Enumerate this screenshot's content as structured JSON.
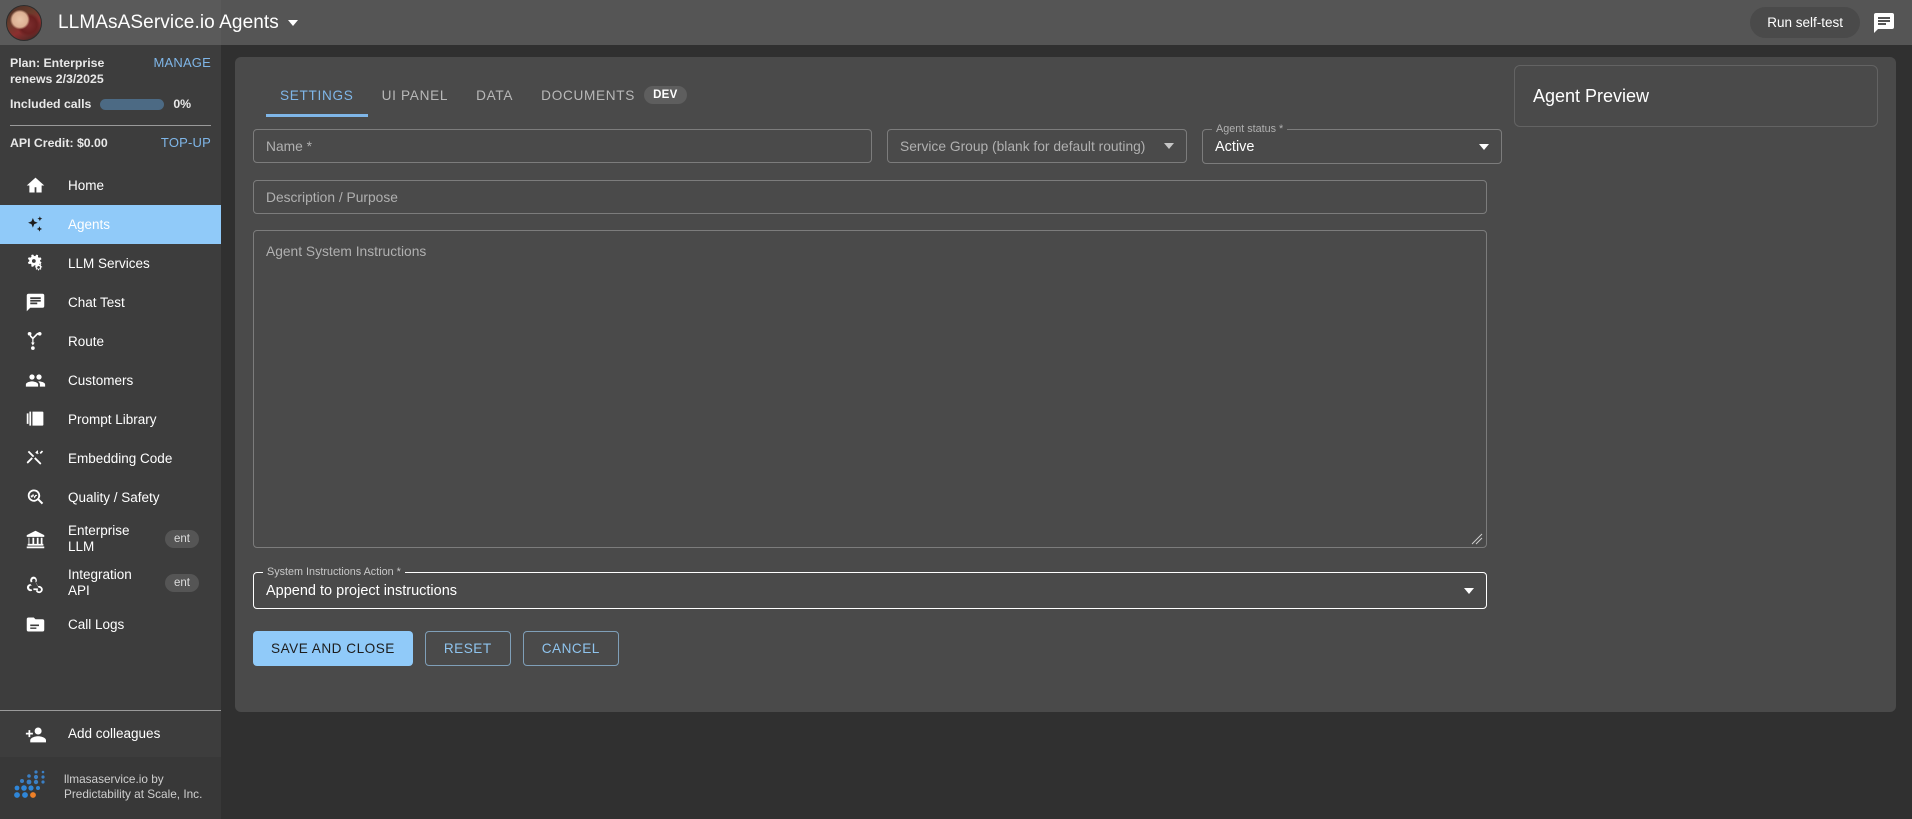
{
  "topbar": {
    "app_title": "LLMAsAService.io Agents",
    "dropdown_icon": "caret-down-icon",
    "avatar": "user-avatar",
    "selftest_label": "Run self-test",
    "chat_icon": "chat-bubble-icon"
  },
  "sidebar": {
    "plan_line1": "Plan: Enterprise",
    "plan_line2": "renews 2/3/2025",
    "manage_label": "MANAGE",
    "included_calls_label": "Included calls",
    "included_calls_pct": "0%",
    "included_calls_value": 0,
    "api_credit_label": "API Credit: $0.00",
    "topup_label": "TOP-UP",
    "items": [
      {
        "label": "Home",
        "icon": "home-icon",
        "active": false,
        "badge": ""
      },
      {
        "label": "Agents",
        "icon": "sparkles-icon",
        "active": true,
        "badge": ""
      },
      {
        "label": "LLM Services",
        "icon": "gears-icon",
        "active": false,
        "badge": ""
      },
      {
        "label": "Chat Test",
        "icon": "chat-bubble-icon",
        "active": false,
        "badge": ""
      },
      {
        "label": "Route",
        "icon": "route-branch-icon",
        "active": false,
        "badge": ""
      },
      {
        "label": "Customers",
        "icon": "people-icon",
        "active": false,
        "badge": ""
      },
      {
        "label": "Prompt Library",
        "icon": "library-books-icon",
        "active": false,
        "badge": ""
      },
      {
        "label": "Embedding Code",
        "icon": "code-tools-icon",
        "active": false,
        "badge": ""
      },
      {
        "label": "Quality / Safety",
        "icon": "magnify-pulse-icon",
        "active": false,
        "badge": ""
      },
      {
        "label": "Enterprise\nLLM",
        "icon": "bank-icon",
        "active": false,
        "badge": "ent"
      },
      {
        "label": "Integration\nAPI",
        "icon": "webhook-icon",
        "active": false,
        "badge": "ent"
      },
      {
        "label": "Call Logs",
        "icon": "folder-list-icon",
        "active": false,
        "badge": ""
      }
    ],
    "add_colleagues_label": "Add colleagues",
    "add_colleagues_icon": "person-add-icon",
    "brand_line1": "llmasaservice.io by",
    "brand_line2": "Predictability at Scale, Inc.",
    "brand_icon": "dot-cluster-logo"
  },
  "tabs": [
    {
      "label": "SETTINGS",
      "active": true,
      "badge": ""
    },
    {
      "label": "UI PANEL",
      "active": false,
      "badge": ""
    },
    {
      "label": "DATA",
      "active": false,
      "badge": ""
    },
    {
      "label": "DOCUMENTS",
      "active": false,
      "badge": "DEV"
    }
  ],
  "form": {
    "name_placeholder": "Name *",
    "name_value": "",
    "service_group_placeholder": "Service Group (blank for default routing)",
    "service_group_value": "",
    "agent_status_legend": "Agent status *",
    "agent_status_value": "Active",
    "description_placeholder": "Description / Purpose",
    "description_value": "",
    "instructions_placeholder": "Agent System Instructions",
    "instructions_value": "",
    "sia_legend": "System Instructions Action *",
    "sia_value": "Append to project instructions",
    "save_label": "SAVE AND CLOSE",
    "reset_label": "RESET",
    "cancel_label": "CANCEL"
  },
  "preview": {
    "title": "Agent Preview"
  },
  "colors": {
    "accent_blue": "#90caf9",
    "link_blue": "#7fb6e8",
    "card_bg": "#4a4a4a",
    "page_bg": "#303030",
    "sidebar_bg": "#3d3d3d",
    "topbar_bg": "#555555"
  }
}
